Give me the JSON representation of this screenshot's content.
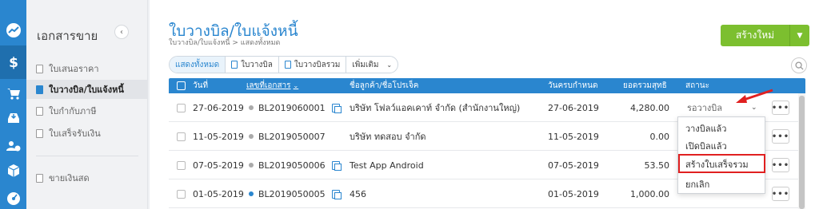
{
  "rail": {
    "icons": [
      "logo-icon",
      "dollar-icon",
      "cart-icon",
      "inbox-icon",
      "contacts-icon",
      "box-icon",
      "gauge-icon"
    ],
    "accent": "#2a86cf"
  },
  "sidebar": {
    "title": "เอกสารขาย",
    "items": [
      {
        "label": "ใบเสนอราคา"
      },
      {
        "label": "ใบวางบิล/ใบแจ้งหนี้"
      },
      {
        "label": "ใบกำกับภาษี"
      },
      {
        "label": "ใบเสร็จรับเงิน"
      },
      {
        "label": "ขายเงินสด"
      }
    ]
  },
  "header": {
    "title": "ใบวางบิล/ใบแจ้งหนี้",
    "breadcrumb": "ใบวางบิล/ใบแจ้งหนี้ > แสดงทั้งหมด",
    "create_label": "สร้างใหม่",
    "create_color": "#7cbf2f"
  },
  "filters": {
    "all": "แสดงทั้งหมด",
    "billing": "ใบวางบิล",
    "combined": "ใบวางบิลรวม",
    "more": "เพิ่มเติม"
  },
  "table": {
    "headers": {
      "date": "วันที่",
      "doc_no": "เลขที่เอกสาร",
      "customer": "ชื่อลูกค้า/ชื่อโปรเจ็ค",
      "due": "วันครบกำหนด",
      "total": "ยอดรวมสุทธิ",
      "status": "สถานะ"
    },
    "rows": [
      {
        "date": "27-06-2019",
        "doc_no": "BL2019060001",
        "customer": "บริษัท โฟลว์แอคเคาท์ จำกัด (สำนักงานใหญ่)",
        "due": "27-06-2019",
        "total": "4,280.00",
        "status": "รอวางบิล"
      },
      {
        "date": "11-05-2019",
        "doc_no": "BL2019050007",
        "customer": "บริษัท ทดสอบ จำกัด",
        "due": "11-05-2019",
        "total": "0.00",
        "status": ""
      },
      {
        "date": "07-05-2019",
        "doc_no": "BL2019050006",
        "customer": "Test App Android",
        "due": "07-05-2019",
        "total": "53.50",
        "status": ""
      },
      {
        "date": "01-05-2019",
        "doc_no": "BL2019050005",
        "customer": "456",
        "due": "01-05-2019",
        "total": "1,000.00",
        "status": ""
      }
    ]
  },
  "status_menu": {
    "items": [
      "วางบิลแล้ว",
      "เปิดบิลแล้ว",
      "สร้างใบเสร็จรวม",
      "ยกเลิก"
    ],
    "highlight_color": "#e02020"
  }
}
